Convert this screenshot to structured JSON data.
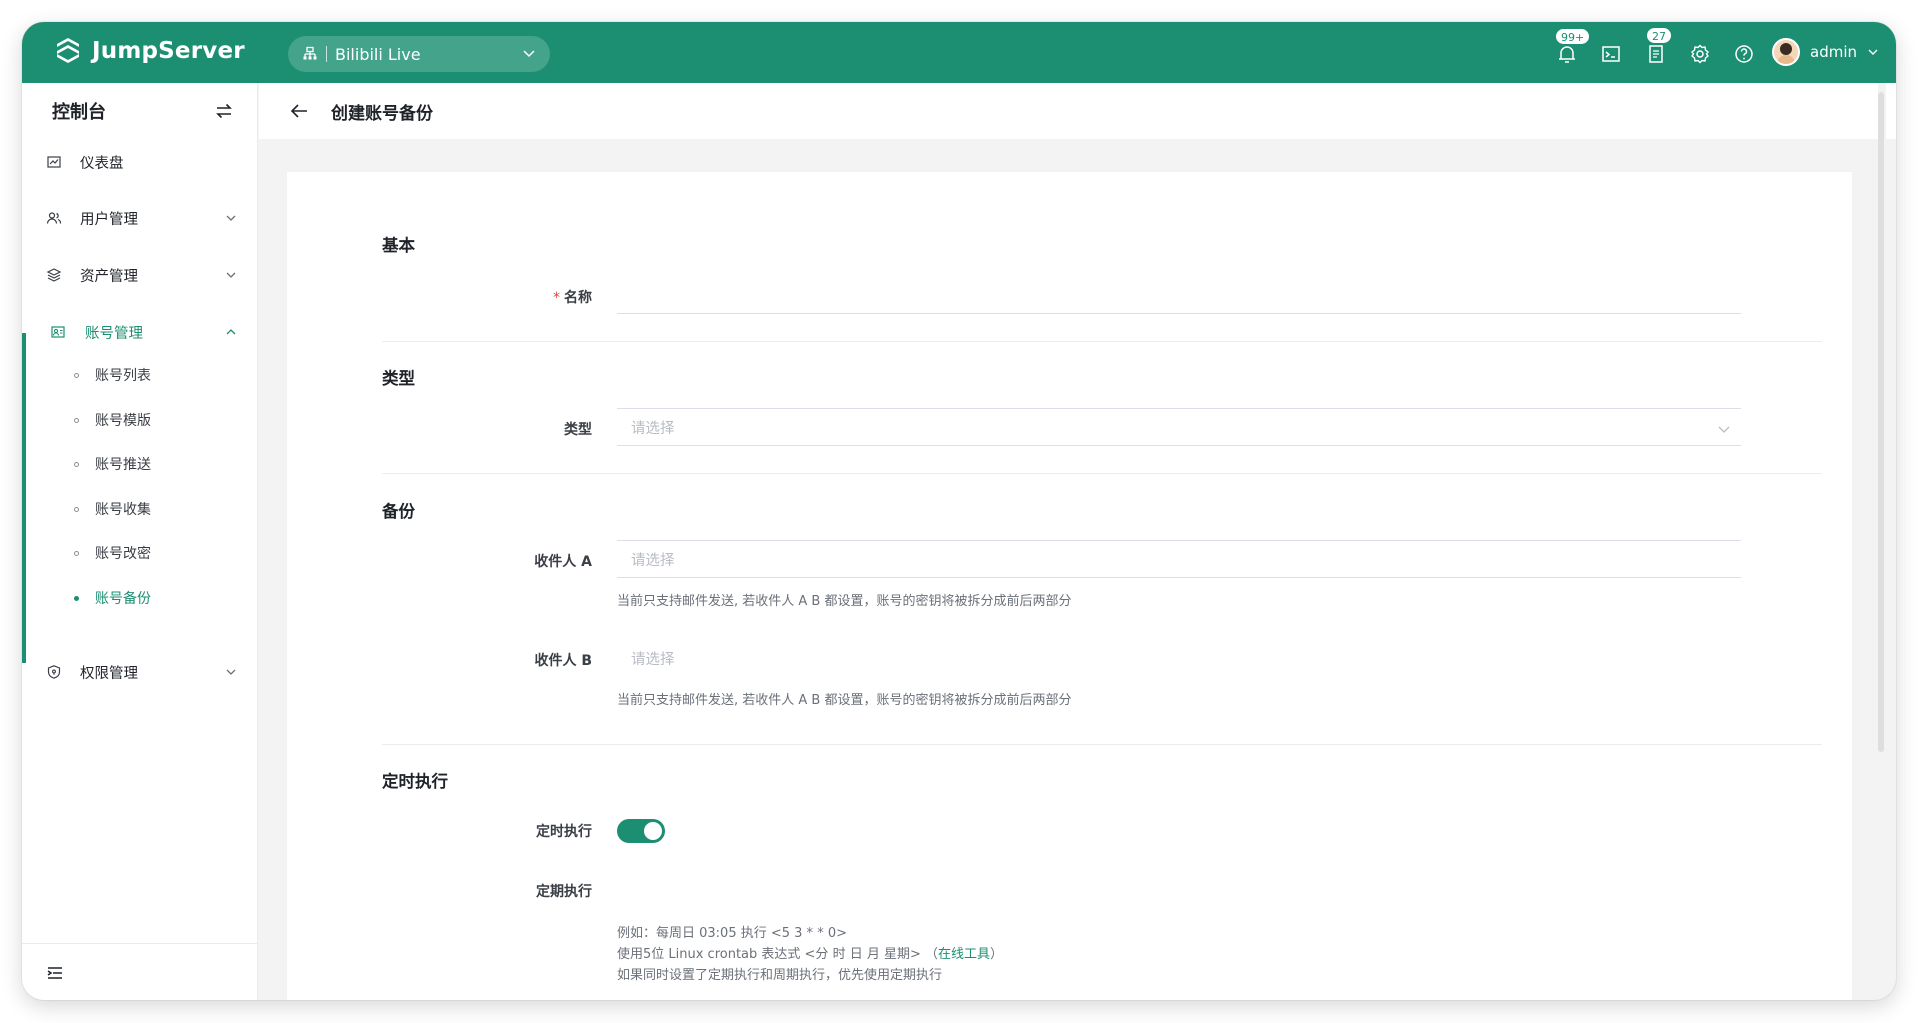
{
  "app": {
    "brand": "JumpServer",
    "organization": "Bilibili Live",
    "notifications_badge": "99+",
    "tasks_badge": "27",
    "username": "admin"
  },
  "colors": {
    "brand": "#1c8f72",
    "required": "#e54545"
  },
  "sidebar": {
    "title": "控制台",
    "items": [
      {
        "label": "仪表盘",
        "icon": "dashboard-icon"
      },
      {
        "label": "用户管理",
        "icon": "users-icon"
      },
      {
        "label": "资产管理",
        "icon": "layers-icon"
      },
      {
        "label": "账号管理",
        "icon": "account-icon",
        "expanded": true
      },
      {
        "label": "权限管理",
        "icon": "shield-icon"
      }
    ],
    "account_sub_items": [
      "账号列表",
      "账号模版",
      "账号推送",
      "账号收集",
      "账号改密",
      "账号备份"
    ],
    "current_sub_item": "账号备份"
  },
  "page": {
    "title": "创建账号备份"
  },
  "form": {
    "sections": {
      "basic": "基本",
      "type": "类型",
      "backup": "备份",
      "schedule": "定时执行"
    },
    "name_label": "名称",
    "name_required_mark": "*",
    "type_label": "类型",
    "type_placeholder": "请选择",
    "recipient_a_label": "收件人 A",
    "recipient_a_placeholder": "请选择",
    "recipient_b_label": "收件人 B",
    "recipient_b_placeholder": "请选择",
    "recipient_hint": "当前只支持邮件发送, 若收件人 A B 都设置，账号的密钥将被拆分成前后两部分",
    "scheduled_label": "定时执行",
    "scheduled_enabled": true,
    "periodic_label": "定期执行",
    "crontab_hint_1": "例如：每周日 03:05 执行 <5 3 * * 0>",
    "crontab_hint_2_prefix": "使用5位 Linux crontab 表达式 <分 时 日 月 星期> （",
    "crontab_hint_2_link": "在线工具",
    "crontab_hint_2_suffix": "）",
    "crontab_hint_3": "如果同时设置了定期执行和周期执行，优先使用定期执行"
  }
}
